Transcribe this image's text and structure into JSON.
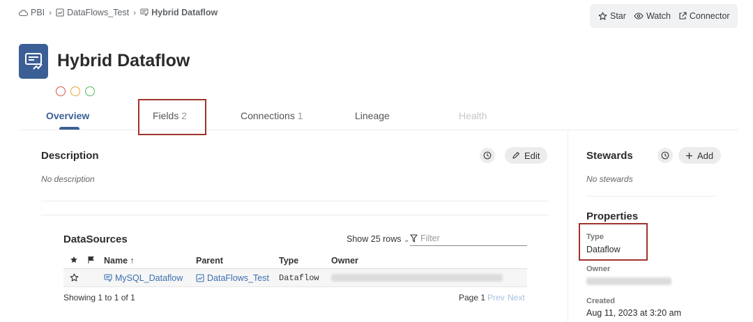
{
  "breadcrumb": {
    "items": [
      {
        "label": "PBI",
        "icon": "cloud-icon"
      },
      {
        "label": "DataFlows_Test",
        "icon": "dataflow-folder-icon"
      },
      {
        "label": "Hybrid Dataflow",
        "icon": "dataflow-icon"
      }
    ]
  },
  "actions": {
    "star": "Star",
    "watch": "Watch",
    "connector": "Connector"
  },
  "header": {
    "title": "Hybrid Dataflow",
    "status_colors": [
      "#d9534f",
      "#e8a53c",
      "#5cb85c"
    ]
  },
  "tabs": [
    {
      "label": "Overview",
      "count": "",
      "state": "active"
    },
    {
      "label": "Fields",
      "count": "2",
      "state": "normal"
    },
    {
      "label": "Connections",
      "count": "1",
      "state": "normal"
    },
    {
      "label": "Lineage",
      "count": "",
      "state": "normal"
    },
    {
      "label": "Health",
      "count": "",
      "state": "disabled"
    }
  ],
  "description": {
    "heading": "Description",
    "empty_text": "No description",
    "edit_label": "Edit"
  },
  "datasources": {
    "heading": "DataSources",
    "show_rows": "Show 25 rows",
    "filter_placeholder": "Filter",
    "columns": [
      "Name",
      "Parent",
      "Type",
      "Owner"
    ],
    "sort_arrow": "↑",
    "rows": [
      {
        "name": "MySQL_Dataflow",
        "parent": "DataFlows_Test",
        "type": "Dataflow"
      }
    ],
    "summary": "Showing 1 to 1 of 1",
    "page": "Page 1",
    "prev": "Prev",
    "next": "Next"
  },
  "stewards": {
    "heading": "Stewards",
    "empty_text": "No stewards",
    "add_label": "Add"
  },
  "properties": {
    "heading": "Properties",
    "type_label": "Type",
    "type_value": "Dataflow",
    "owner_label": "Owner",
    "created_label": "Created",
    "created_value": "Aug 11, 2023 at 3:20 am"
  },
  "colors": {
    "accent": "#3b5f95",
    "link": "#3b6fb0",
    "highlight_box": "#a0332c"
  }
}
